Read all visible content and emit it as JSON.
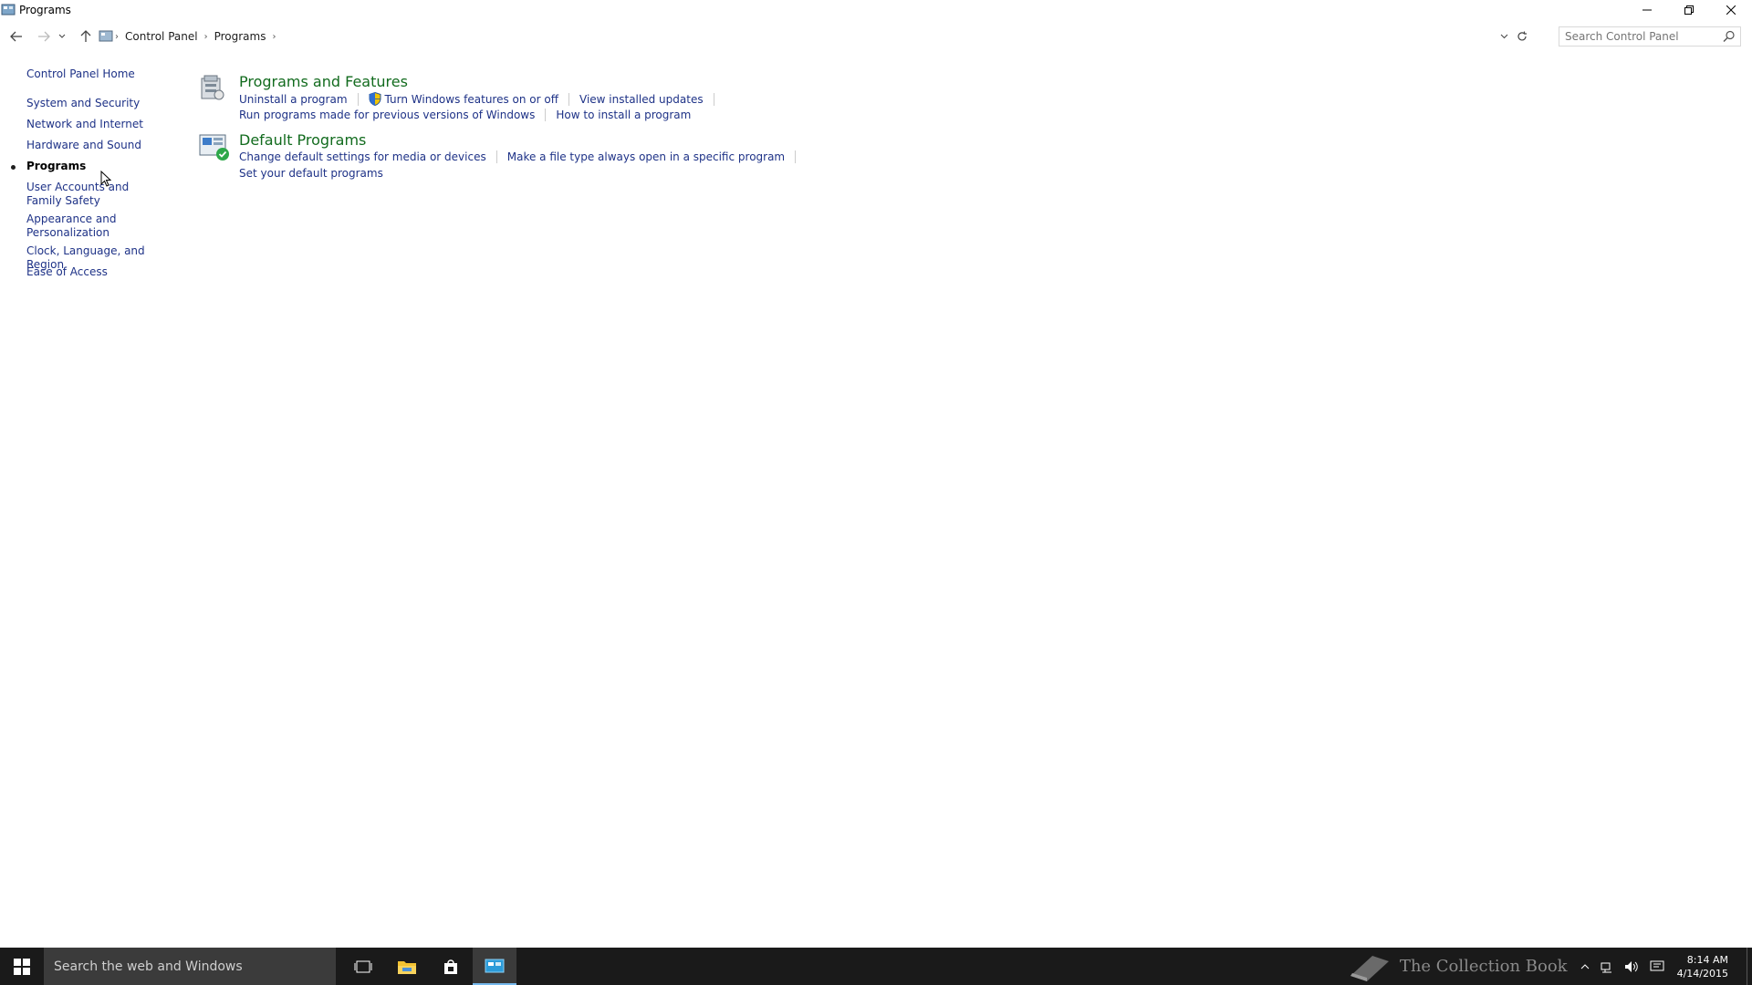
{
  "window": {
    "title": "Programs"
  },
  "address": {
    "crumbs": [
      "Control Panel",
      "Programs"
    ],
    "search_placeholder": "Search Control Panel"
  },
  "sidebar": {
    "home": "Control Panel Home",
    "items": [
      {
        "label": "System and Security",
        "active": false
      },
      {
        "label": "Network and Internet",
        "active": false
      },
      {
        "label": "Hardware and Sound",
        "active": false
      },
      {
        "label": "Programs",
        "active": true
      },
      {
        "label": "User Accounts and Family Safety",
        "active": false
      },
      {
        "label": "Appearance and Personalization",
        "active": false
      },
      {
        "label": "Clock, Language, and Region",
        "active": false
      },
      {
        "label": "Ease of Access",
        "active": false
      }
    ]
  },
  "sections": [
    {
      "heading": "Programs and Features",
      "icon": "programs-features-icon",
      "links_row1": [
        "Uninstall a program",
        "Turn Windows features on or off",
        "View installed updates"
      ],
      "links_row2": [
        "Run programs made for previous versions of Windows",
        "How to install a program"
      ]
    },
    {
      "heading": "Default Programs",
      "icon": "default-programs-icon",
      "links_row1": [
        "Change default settings for media or devices",
        "Make a file type always open in a specific program"
      ],
      "links_row2": [
        "Set your default programs"
      ]
    }
  ],
  "taskbar": {
    "search_placeholder": "Search the web and Windows",
    "watermark": "The Collection Book",
    "time": "8:14 AM",
    "date": "4/14/2015"
  },
  "colors": {
    "link": "#1e3287",
    "heading": "#126b1e",
    "taskbar": "#1a1a1a"
  }
}
